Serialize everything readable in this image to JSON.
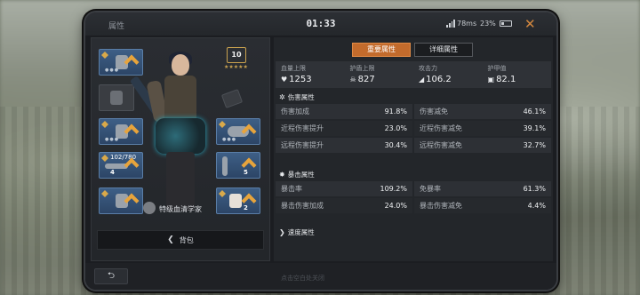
{
  "header": {
    "title": "属性",
    "time": "01:33",
    "ping": "78ms",
    "battery": "23%",
    "close_icon": "close-x-icon"
  },
  "character": {
    "level": "10",
    "title": "特级血清学家"
  },
  "slots": {
    "weapon_ammo": "102/780",
    "weapon_count": "4",
    "gear_count_1": "5",
    "gear_count_2": "2"
  },
  "left": {
    "backpack_label": "背包"
  },
  "tabs": [
    {
      "label": "重要属性",
      "active": true
    },
    {
      "label": "详细属性",
      "active": false
    }
  ],
  "summary": [
    {
      "label": "血量上限",
      "value": "1253",
      "icon": "heart-icon"
    },
    {
      "label": "护盾上限",
      "value": "827",
      "icon": "skull-shield-icon"
    },
    {
      "label": "攻击力",
      "value": "106.2",
      "icon": "gun-icon"
    },
    {
      "label": "护甲值",
      "value": "82.1",
      "icon": "armor-icon"
    }
  ],
  "sections": {
    "damage": {
      "title": "伤害属性",
      "rows": [
        [
          {
            "k": "伤害加成",
            "v": "91.8%"
          },
          {
            "k": "伤害减免",
            "v": "46.1%"
          }
        ],
        [
          {
            "k": "近程伤害提升",
            "v": "23.0%"
          },
          {
            "k": "近程伤害减免",
            "v": "39.1%"
          }
        ],
        [
          {
            "k": "远程伤害提升",
            "v": "30.4%"
          },
          {
            "k": "远程伤害减免",
            "v": "32.7%"
          }
        ]
      ]
    },
    "crit": {
      "title": "暴击属性",
      "rows": [
        [
          {
            "k": "暴击率",
            "v": "109.2%"
          },
          {
            "k": "免暴率",
            "v": "61.3%"
          }
        ],
        [
          {
            "k": "暴击伤害加成",
            "v": "24.0%"
          },
          {
            "k": "暴击伤害减免",
            "v": "4.4%"
          }
        ]
      ]
    },
    "speed": {
      "title": "速度属性"
    }
  },
  "footer": {
    "hint": "点击空白处关闭"
  }
}
